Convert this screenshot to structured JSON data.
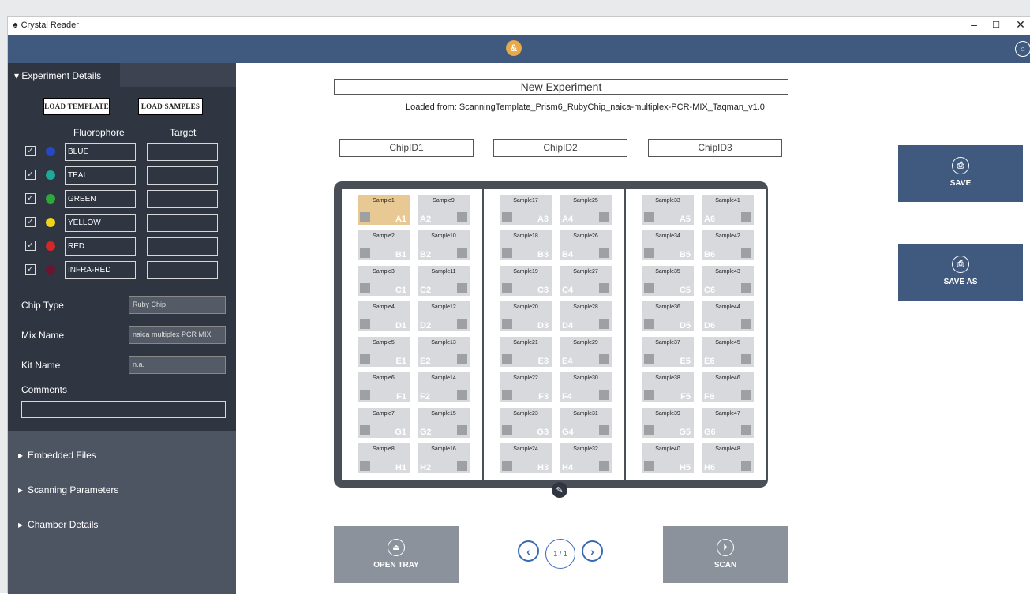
{
  "window": {
    "title": "Crystal Reader",
    "min": "–",
    "max": "☐",
    "close": "✕"
  },
  "header": {
    "logo_icon": "app-logo-icon",
    "home_icon": "home-icon"
  },
  "sidebar": {
    "tab_label": "▾ Experiment Details",
    "load_template": "LOAD TEMPLATE",
    "load_samples": "LOAD SAMPLES",
    "col_fluorophore": "Fluorophore",
    "col_target": "Target",
    "fluorophores": [
      {
        "name": "BLUE",
        "color": "#2548c6",
        "checked": true,
        "target": ""
      },
      {
        "name": "TEAL",
        "color": "#1fa89a",
        "checked": true,
        "target": ""
      },
      {
        "name": "GREEN",
        "color": "#2ea83a",
        "checked": true,
        "target": ""
      },
      {
        "name": "YELLOW",
        "color": "#f0d41c",
        "checked": true,
        "target": ""
      },
      {
        "name": "RED",
        "color": "#d62626",
        "checked": true,
        "target": ""
      },
      {
        "name": "INFRA-RED",
        "color": "#6b1530",
        "checked": true,
        "target": ""
      }
    ],
    "chip_type_label": "Chip Type",
    "chip_type_value": "Ruby Chip",
    "mix_name_label": "Mix Name",
    "mix_name_value": "naica multiplex PCR MIX",
    "kit_name_label": "Kit Name",
    "kit_name_value": "n.a.",
    "comments_label": "Comments",
    "comments_value": "",
    "sections": [
      "Embedded Files",
      "Scanning Parameters",
      "Chamber Details"
    ]
  },
  "main": {
    "experiment_title": "New Experiment",
    "loaded_from": "Loaded from: ScanningTemplate_Prism6_RubyChip_naica-multiplex-PCR-MIX_Taqman_v1.0",
    "chip_ids": [
      "ChipID1",
      "ChipID2",
      "ChipID3"
    ],
    "chips": [
      {
        "wells": [
          {
            "name": "Sample1",
            "well": "A1",
            "selected": true
          },
          {
            "name": "Sample9",
            "well": "A2"
          },
          {
            "name": "Sample2",
            "well": "B1"
          },
          {
            "name": "Sample10",
            "well": "B2"
          },
          {
            "name": "Sample3",
            "well": "C1"
          },
          {
            "name": "Sample11",
            "well": "C2"
          },
          {
            "name": "Sample4",
            "well": "D1"
          },
          {
            "name": "Sample12",
            "well": "D2"
          },
          {
            "name": "Sample5",
            "well": "E1"
          },
          {
            "name": "Sample13",
            "well": "E2"
          },
          {
            "name": "Sample6",
            "well": "F1"
          },
          {
            "name": "Sample14",
            "well": "F2"
          },
          {
            "name": "Sample7",
            "well": "G1"
          },
          {
            "name": "Sample15",
            "well": "G2"
          },
          {
            "name": "Sample8",
            "well": "H1"
          },
          {
            "name": "Sample16",
            "well": "H2"
          }
        ]
      },
      {
        "wells": [
          {
            "name": "Sample17",
            "well": "A3"
          },
          {
            "name": "Sample25",
            "well": "A4"
          },
          {
            "name": "Sample18",
            "well": "B3"
          },
          {
            "name": "Sample26",
            "well": "B4"
          },
          {
            "name": "Sample19",
            "well": "C3"
          },
          {
            "name": "Sample27",
            "well": "C4"
          },
          {
            "name": "Sample20",
            "well": "D3"
          },
          {
            "name": "Sample28",
            "well": "D4"
          },
          {
            "name": "Sample21",
            "well": "E3"
          },
          {
            "name": "Sample29",
            "well": "E4"
          },
          {
            "name": "Sample22",
            "well": "F3"
          },
          {
            "name": "Sample30",
            "well": "F4"
          },
          {
            "name": "Sample23",
            "well": "G3"
          },
          {
            "name": "Sample31",
            "well": "G4"
          },
          {
            "name": "Sample24",
            "well": "H3"
          },
          {
            "name": "Sample32",
            "well": "H4"
          }
        ]
      },
      {
        "wells": [
          {
            "name": "Sample33",
            "well": "A5"
          },
          {
            "name": "Sample41",
            "well": "A6"
          },
          {
            "name": "Sample34",
            "well": "B5"
          },
          {
            "name": "Sample42",
            "well": "B6"
          },
          {
            "name": "Sample35",
            "well": "C5"
          },
          {
            "name": "Sample43",
            "well": "C6"
          },
          {
            "name": "Sample36",
            "well": "D5"
          },
          {
            "name": "Sample44",
            "well": "D6"
          },
          {
            "name": "Sample37",
            "well": "E5"
          },
          {
            "name": "Sample45",
            "well": "E6"
          },
          {
            "name": "Sample38",
            "well": "F5"
          },
          {
            "name": "Sample46",
            "well": "F6"
          },
          {
            "name": "Sample39",
            "well": "G5"
          },
          {
            "name": "Sample47",
            "well": "G6"
          },
          {
            "name": "Sample40",
            "well": "H5"
          },
          {
            "name": "Sample48",
            "well": "H6"
          }
        ]
      }
    ],
    "open_tray": "OPEN TRAY",
    "scan": "SCAN",
    "page_indicator": "1 / 1",
    "save": "SAVE",
    "save_as": "SAVE AS"
  },
  "colors": {
    "header": "#3f5a7e",
    "sidebar": "#2f3541",
    "accent": "#3a69b5",
    "selected_well": "#e8c993"
  }
}
